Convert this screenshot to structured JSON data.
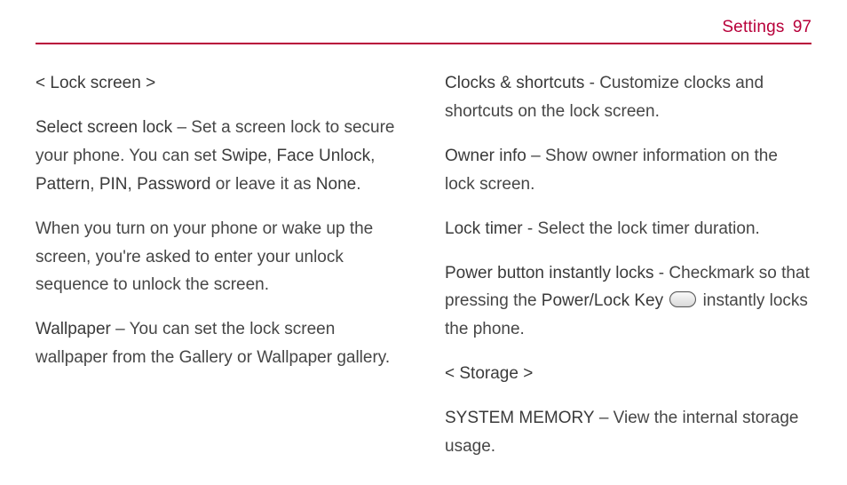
{
  "header": {
    "section": "Settings",
    "page": "97"
  },
  "left": {
    "h1": "< Lock screen >",
    "p1_lead": "Select screen lock",
    "p1_a": " – Set a screen lock to secure your phone. You can set ",
    "p1_opt1": "Swipe",
    "p1_s1": ", ",
    "p1_opt2": "Face Unlock",
    "p1_s2": ", ",
    "p1_opt3": "Pattern",
    "p1_s3": ", ",
    "p1_opt4": "PIN",
    "p1_s4": ", ",
    "p1_opt5": "Password",
    "p1_b": " or leave it as ",
    "p1_opt6": "None",
    "p1_end": ".",
    "p2": "When you turn on your phone or wake up the screen, you're asked to enter your unlock sequence to unlock the screen.",
    "p3_lead": "Wallpaper",
    "p3_rest": " – You can set the lock screen wallpaper from the Gallery or Wallpaper gallery."
  },
  "right": {
    "p1_lead": "Clocks & shortcuts",
    "p1_rest": " - Customize clocks and shortcuts on the lock screen.",
    "p2_lead": "Owner info",
    "p2_rest": " – Show owner information on the lock screen.",
    "p3_lead": "Lock timer",
    "p3_rest": " - Select the lock timer duration.",
    "p4_lead": "Power button instantly locks",
    "p4_a": " - Checkmark so that pressing the ",
    "p4_key": "Power/Lock Key",
    "p4_b": " instantly locks the phone.",
    "h2": "< Storage >",
    "p5_lead": "SYSTEM MEMORY",
    "p5_rest": " – View the internal storage usage."
  }
}
